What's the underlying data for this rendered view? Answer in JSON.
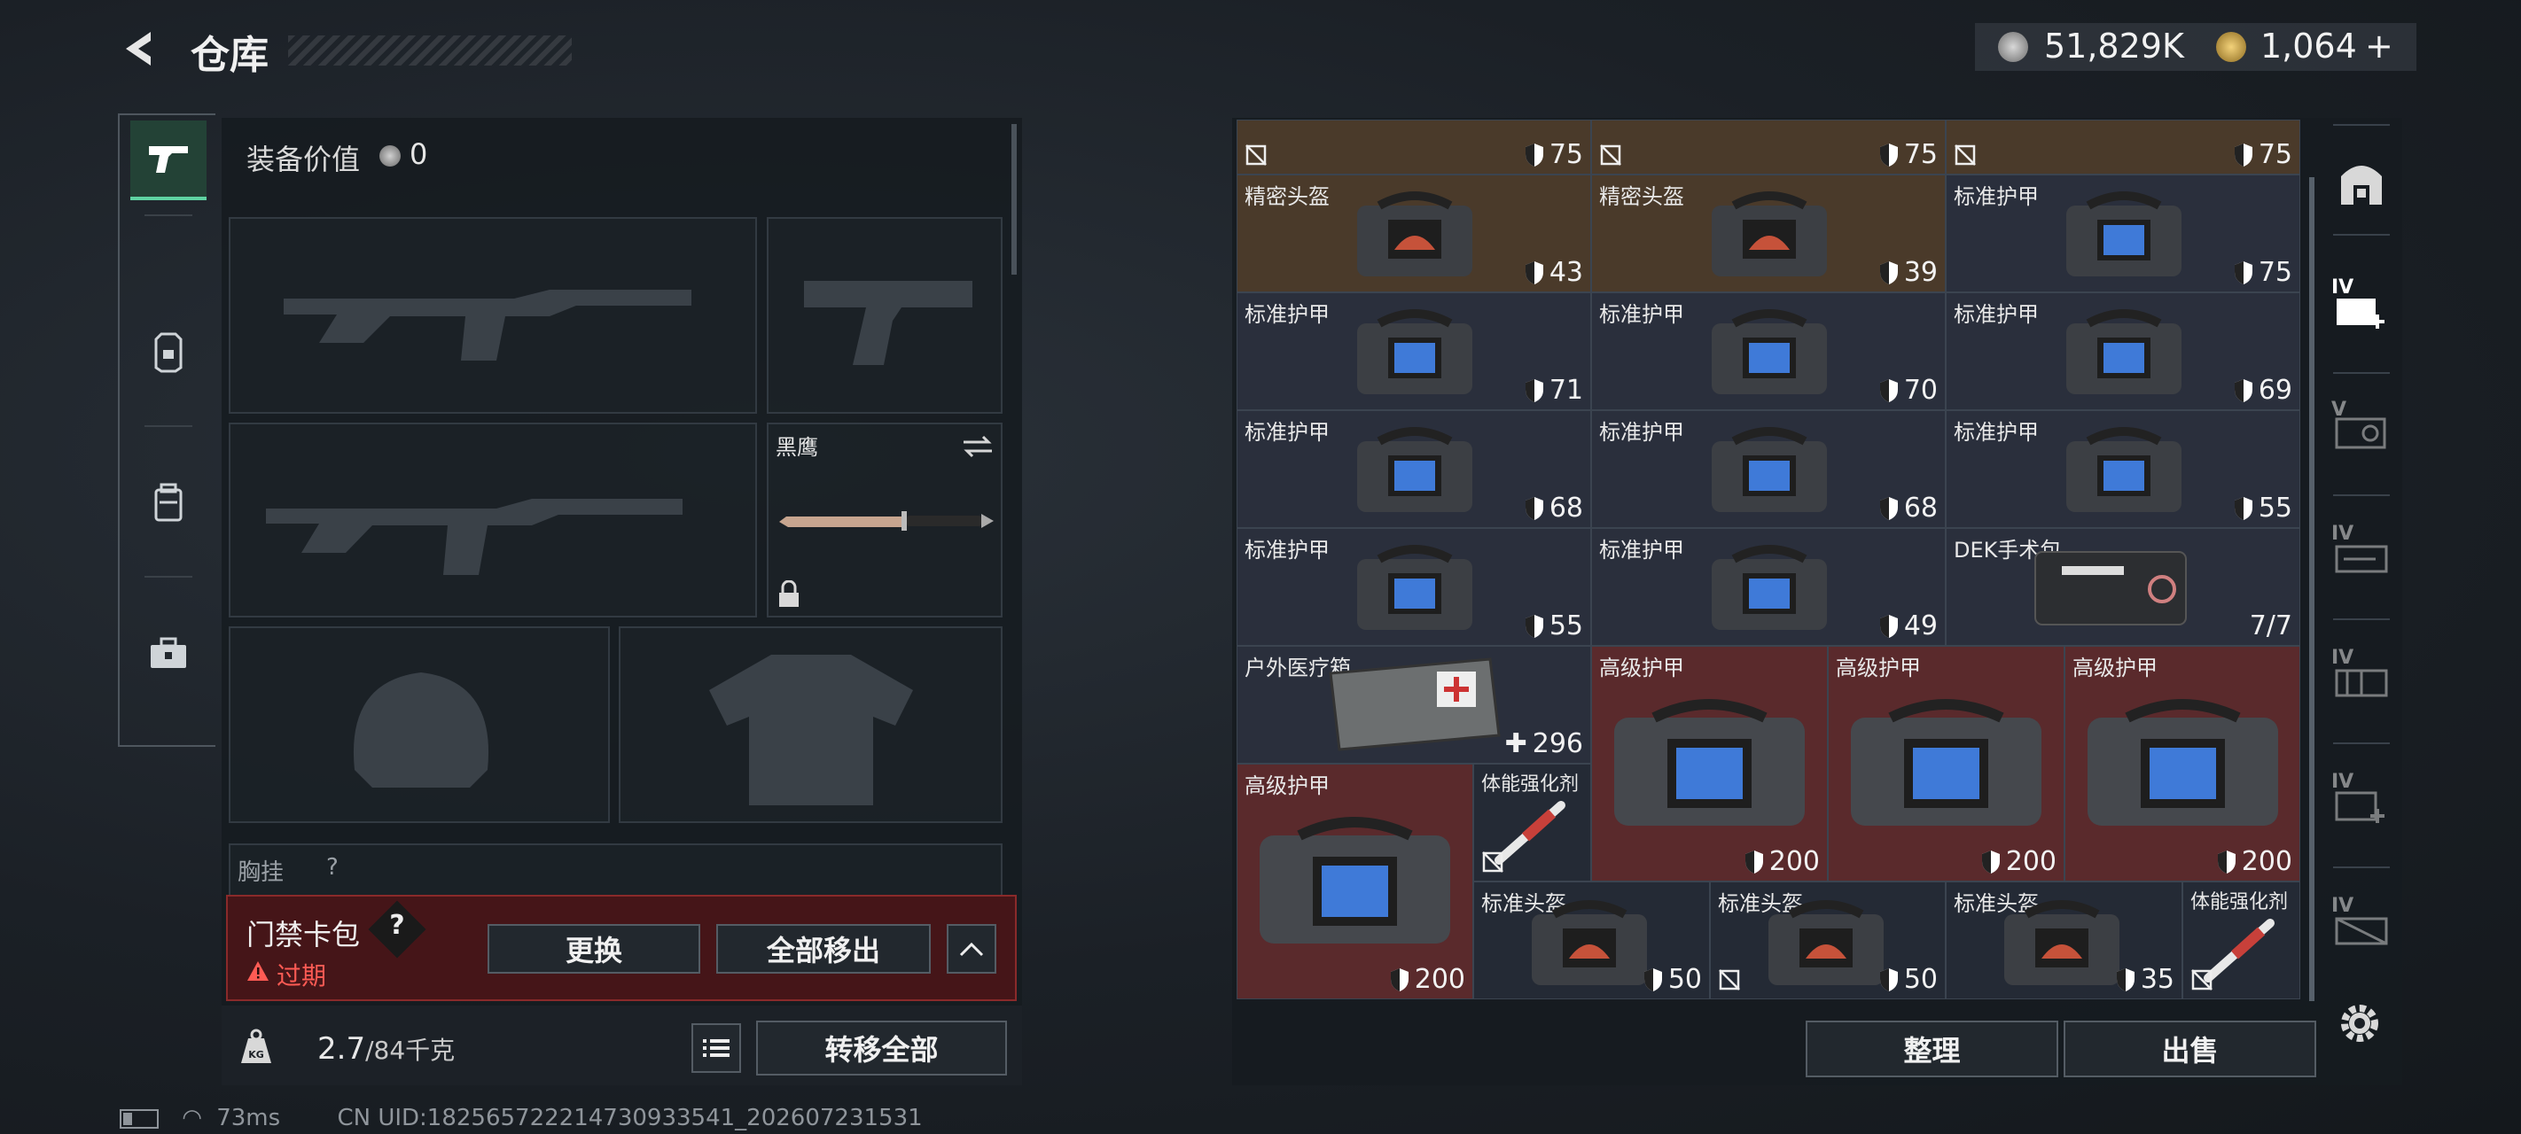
{
  "header": {
    "title": "仓库",
    "silver": "51,829K",
    "gold": "1,064",
    "gold_add": "+"
  },
  "equipment": {
    "value_label": "装备价值",
    "value": "0",
    "knife_name": "黑鹰",
    "chest_rig_label": "胸挂",
    "chest_rig_hint": "?"
  },
  "keycard": {
    "title": "门禁卡包",
    "help": "?",
    "status": "过期",
    "replace": "更换",
    "remove_all": "全部移出"
  },
  "capacity": {
    "current": "2.7",
    "max": "/84千克",
    "transfer_all": "转移全部"
  },
  "status_bar": {
    "ping": "73ms",
    "uid": "CN UID:182565722214730933541_202607231531"
  },
  "inventory": {
    "top_row": [
      "75",
      "75",
      "75"
    ],
    "items": [
      {
        "label": "精密头盔",
        "value": "43"
      },
      {
        "label": "精密头盔",
        "value": "39"
      },
      {
        "label": "标准护甲",
        "value": "75"
      },
      {
        "label": "标准护甲",
        "value": "71"
      },
      {
        "label": "标准护甲",
        "value": "70"
      },
      {
        "label": "标准护甲",
        "value": "69"
      },
      {
        "label": "标准护甲",
        "value": "68"
      },
      {
        "label": "标准护甲",
        "value": "68"
      },
      {
        "label": "标准护甲",
        "value": "55"
      },
      {
        "label": "标准护甲",
        "value": "55"
      },
      {
        "label": "标准护甲",
        "value": "49"
      },
      {
        "label": "DEK手术包",
        "value": "7/7"
      },
      {
        "label": "户外医疗箱",
        "value": "296"
      },
      {
        "label": "高级护甲",
        "value": "200"
      },
      {
        "label": "高级护甲",
        "value": "200"
      },
      {
        "label": "高级护甲",
        "value": "200"
      },
      {
        "label": "高级护甲",
        "value": "200"
      },
      {
        "label": "体能强化剂",
        "value": ""
      },
      {
        "label": "标准头盔",
        "value": "50"
      },
      {
        "label": "标准头盔",
        "value": "50"
      },
      {
        "label": "标准头盔",
        "value": "35"
      },
      {
        "label": "体能强化剂",
        "value": ""
      }
    ],
    "sort": "整理",
    "sell": "出售"
  },
  "right_nav": {
    "roman": [
      "IV",
      "V",
      "IV",
      "IV",
      "IV",
      "IV"
    ]
  },
  "colors": {
    "accent": "#5fd3a2",
    "danger": "#ff5b54",
    "rare_bg": "#5a2a2c",
    "gold_bg": "#4a3a2a"
  }
}
